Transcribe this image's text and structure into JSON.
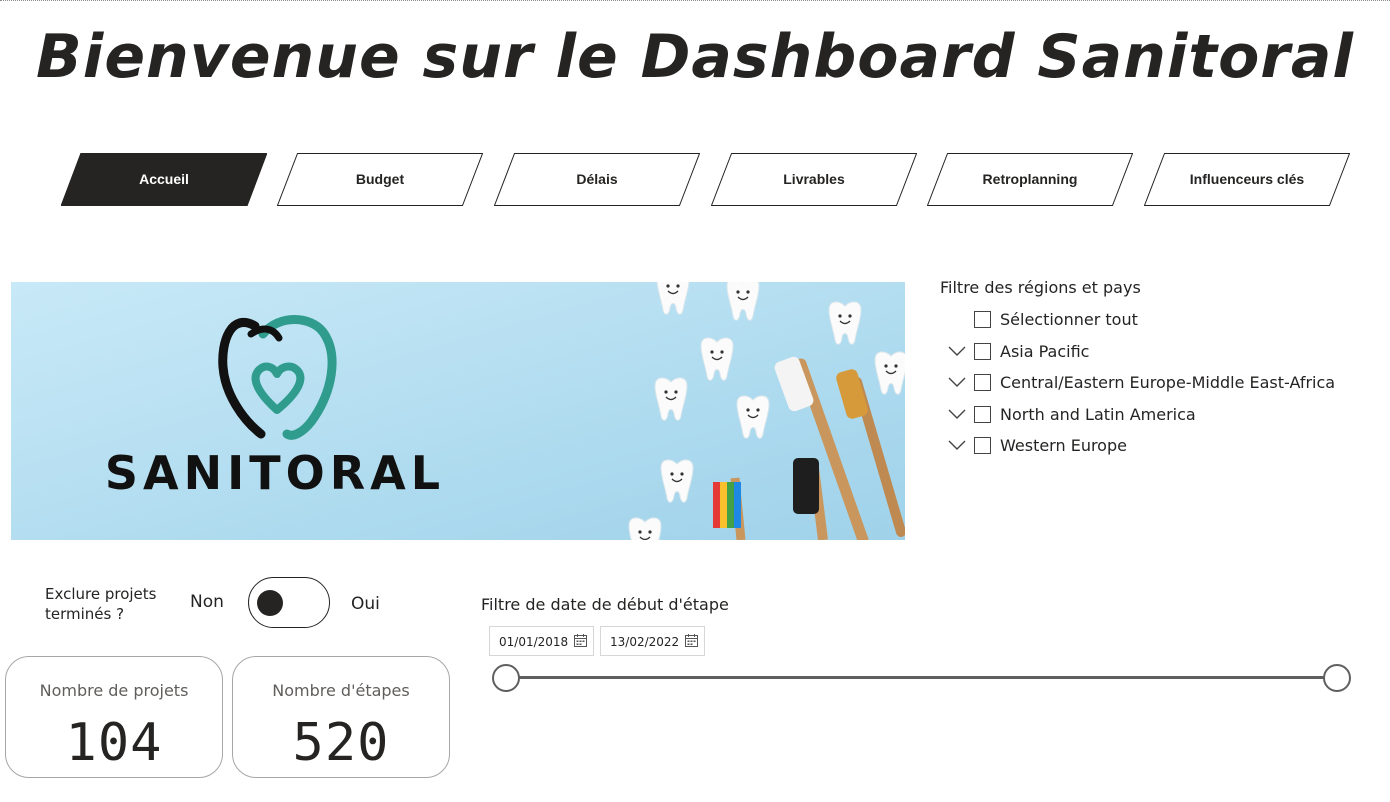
{
  "title": "Bienvenue sur le Dashboard Sanitoral",
  "nav": {
    "tabs": [
      {
        "label": "Accueil",
        "active": true
      },
      {
        "label": "Budget",
        "active": false
      },
      {
        "label": "Délais",
        "active": false
      },
      {
        "label": "Livrables",
        "active": false
      },
      {
        "label": "Retroplanning",
        "active": false
      },
      {
        "label": "Influenceurs clés",
        "active": false
      }
    ]
  },
  "banner": {
    "brand": "SANITORAL",
    "logo_icon": "tooth-heart-icon",
    "background_color": "#bfe3f2",
    "logo_colors": {
      "outline": "#111111",
      "accent": "#2f9c8e"
    }
  },
  "region_filter": {
    "title": "Filtre des régions et pays",
    "select_all": "Sélectionner tout",
    "items": [
      "Asia Pacific",
      "Central/Eastern Europe-Middle East-Africa",
      "North and Latin America",
      "Western Europe"
    ]
  },
  "toggle": {
    "label_line1": "Exclure projets",
    "label_line2": "terminés ?",
    "off_label": "Non",
    "on_label": "Oui",
    "state": "off"
  },
  "cards": [
    {
      "caption": "Nombre de projets",
      "value": "104"
    },
    {
      "caption": "Nombre d'étapes",
      "value": "520"
    }
  ],
  "date_filter": {
    "title": "Filtre de date de début d'étape",
    "start": "01/01/2018",
    "end": "13/02/2022"
  },
  "colors": {
    "dark": "#252423",
    "slider": "#5f5f5f"
  }
}
